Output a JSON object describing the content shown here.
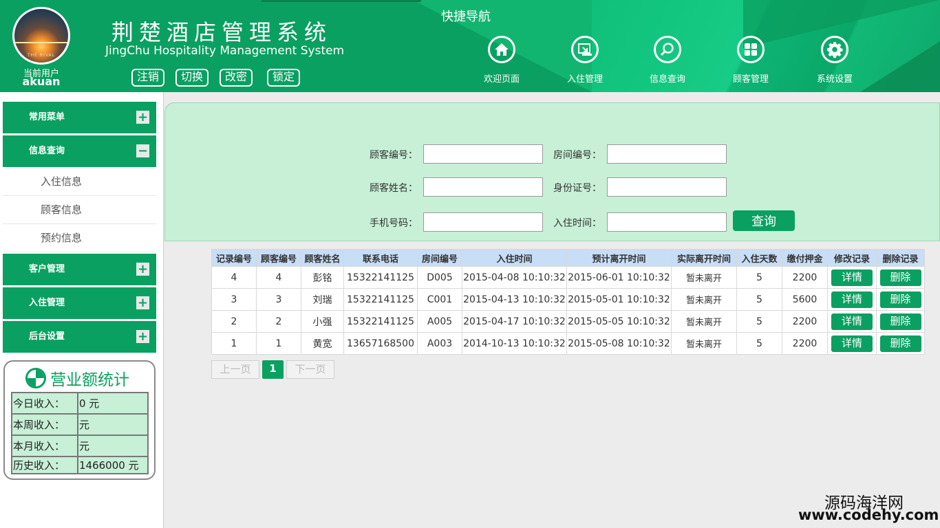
{
  "header": {
    "title": "荆楚酒店管理系统",
    "subtitle": "JingChu Hospitality Management System",
    "avatar_brand": "THE RIVAL",
    "current_user_label": "当前用户",
    "current_user": "akuan",
    "buttons": [
      "注销",
      "切换",
      "改密",
      "锁定"
    ],
    "quick_nav_title": "快捷导航",
    "nav": [
      {
        "label": "欢迎页面",
        "icon": "home-icon"
      },
      {
        "label": "入住管理",
        "icon": "checkin-icon"
      },
      {
        "label": "信息查询",
        "icon": "search-icon"
      },
      {
        "label": "顾客管理",
        "icon": "grid-icon"
      },
      {
        "label": "系统设置",
        "icon": "gear-icon"
      }
    ]
  },
  "sidebar": {
    "menus": [
      "常用菜单",
      "信息查询",
      "客户管理",
      "入住管理",
      "后台设置"
    ],
    "expanded_subitems": [
      "入住信息",
      "顾客信息",
      "预约信息"
    ],
    "toggle_plus": "+",
    "toggle_minus": "−",
    "stats": {
      "title": "营业额统计",
      "rows": [
        {
          "label": "今日收入：",
          "value": "0 元"
        },
        {
          "label": "本周收入：",
          "value": "元"
        },
        {
          "label": "本月收入：",
          "value": "元"
        },
        {
          "label": "历史收入：",
          "value": "1466000 元"
        }
      ]
    }
  },
  "filter": {
    "customer_id": {
      "label": "顾客编号：",
      "value": ""
    },
    "room_id": {
      "label": "房间编号：",
      "value": ""
    },
    "customer_name": {
      "label": "顾客姓名：",
      "value": ""
    },
    "id_card": {
      "label": "身份证号：",
      "value": ""
    },
    "phone": {
      "label": "手机号码：",
      "value": ""
    },
    "checkin_time": {
      "label": "入住时间：",
      "value": ""
    },
    "query_button": "查询"
  },
  "table": {
    "columns": [
      "记录编号",
      "顾客编号",
      "顾客姓名",
      "联系电话",
      "房间编号",
      "入住时间",
      "预计离开时间",
      "实际离开时间",
      "入住天数",
      "缴付押金",
      "修改记录",
      "删除记录"
    ],
    "detail_label": "详情",
    "delete_label": "删除",
    "rows": [
      {
        "record": "4",
        "cust": "4",
        "name": "彭铭",
        "phone": "15322141125",
        "room": "D005",
        "in": "2015-04-08 10:10:32",
        "plan": "2015-06-01 10:10:32",
        "actual": "暂未离开",
        "days": "5",
        "deposit": "2200"
      },
      {
        "record": "3",
        "cust": "3",
        "name": "刘瑞",
        "phone": "15322141125",
        "room": "C001",
        "in": "2015-04-13 10:10:32",
        "plan": "2015-05-01 10:10:32",
        "actual": "暂未离开",
        "days": "5",
        "deposit": "5600"
      },
      {
        "record": "2",
        "cust": "2",
        "name": "小强",
        "phone": "15322141125",
        "room": "A005",
        "in": "2015-04-17 10:10:32",
        "plan": "2015-05-05 10:10:32",
        "actual": "暂未离开",
        "days": "5",
        "deposit": "2200"
      },
      {
        "record": "1",
        "cust": "1",
        "name": "黄宽",
        "phone": "13657168500",
        "room": "A003",
        "in": "2014-10-13 10:10:32",
        "plan": "2015-05-08 10:10:32",
        "actual": "暂未离开",
        "days": "5",
        "deposit": "2200"
      }
    ]
  },
  "pager": {
    "prev": "上一页",
    "current": "1",
    "next": "下一页"
  },
  "watermark": {
    "line1": "源码海洋网",
    "line2": "www.codehy.com"
  },
  "colors": {
    "brand_green": "#0aa061",
    "filter_bg": "#c7f0d7",
    "table_header_bg": "#c8ddf6"
  }
}
